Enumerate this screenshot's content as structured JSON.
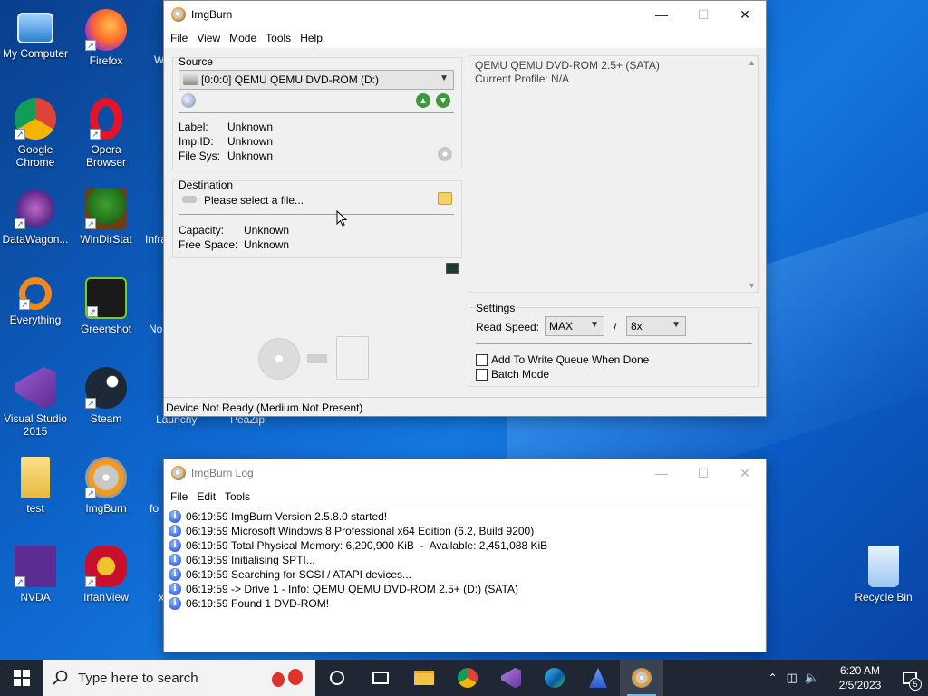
{
  "desktop": {
    "icons": [
      {
        "label": "My Computer"
      },
      {
        "label": "Firefox"
      },
      {
        "label": "Google Chrome"
      },
      {
        "label": "Opera Browser"
      },
      {
        "label": "DataWagon..."
      },
      {
        "label": "WinDirStat"
      },
      {
        "label": "Everything"
      },
      {
        "label": "Greenshot"
      },
      {
        "label": "Visual Studio 2015"
      },
      {
        "label": "Steam"
      },
      {
        "label": "test"
      },
      {
        "label": "ImgBurn"
      },
      {
        "label": "NVDA"
      },
      {
        "label": "IrfanView"
      },
      {
        "label": "Recycle Bin"
      }
    ],
    "partial_labels": [
      "W",
      "Infra",
      "No",
      "Launchy",
      "PeaZip",
      "fo",
      "X"
    ]
  },
  "imgburn": {
    "title": "ImgBurn",
    "menu": [
      "File",
      "View",
      "Mode",
      "Tools",
      "Help"
    ],
    "source": {
      "label": "Source",
      "drive": "[0:0:0] QEMU QEMU DVD-ROM (D:)",
      "fields": [
        {
          "k": "Label:",
          "v": "Unknown"
        },
        {
          "k": "Imp ID:",
          "v": "Unknown"
        },
        {
          "k": "File Sys:",
          "v": "Unknown"
        }
      ]
    },
    "destination": {
      "label": "Destination",
      "placeholder": "Please select a file...",
      "fields": [
        {
          "k": "Capacity:",
          "v": "Unknown"
        },
        {
          "k": "Free Space:",
          "v": "Unknown"
        }
      ]
    },
    "info_panel": {
      "line1": "QEMU QEMU DVD-ROM 2.5+ (SATA)",
      "line2": "Current Profile: N/A"
    },
    "settings": {
      "label": "Settings",
      "read_speed_label": "Read Speed:",
      "read_speed_value": "MAX",
      "separator": "/",
      "speed_value": "8x",
      "write_queue_label": "Add To Write Queue When Done",
      "batch_mode_label": "Batch Mode"
    },
    "status": "Device Not Ready (Medium Not Present)"
  },
  "log": {
    "title": "ImgBurn Log",
    "menu": [
      "File",
      "Edit",
      "Tools"
    ],
    "lines": [
      "06:19:59 ImgBurn Version 2.5.8.0 started!",
      "06:19:59 Microsoft Windows 8 Professional x64 Edition (6.2, Build 9200)",
      "06:19:59 Total Physical Memory: 6,290,900 KiB  -  Available: 2,451,088 KiB",
      "06:19:59 Initialising SPTI...",
      "06:19:59 Searching for SCSI / ATAPI devices...",
      "06:19:59 -> Drive 1 - Info: QEMU QEMU DVD-ROM 2.5+ (D:) (SATA)",
      "06:19:59 Found 1 DVD-ROM!"
    ]
  },
  "taskbar": {
    "search_placeholder": "Type here to search",
    "time": "6:20 AM",
    "date": "2/5/2023",
    "notification_count": "5"
  }
}
